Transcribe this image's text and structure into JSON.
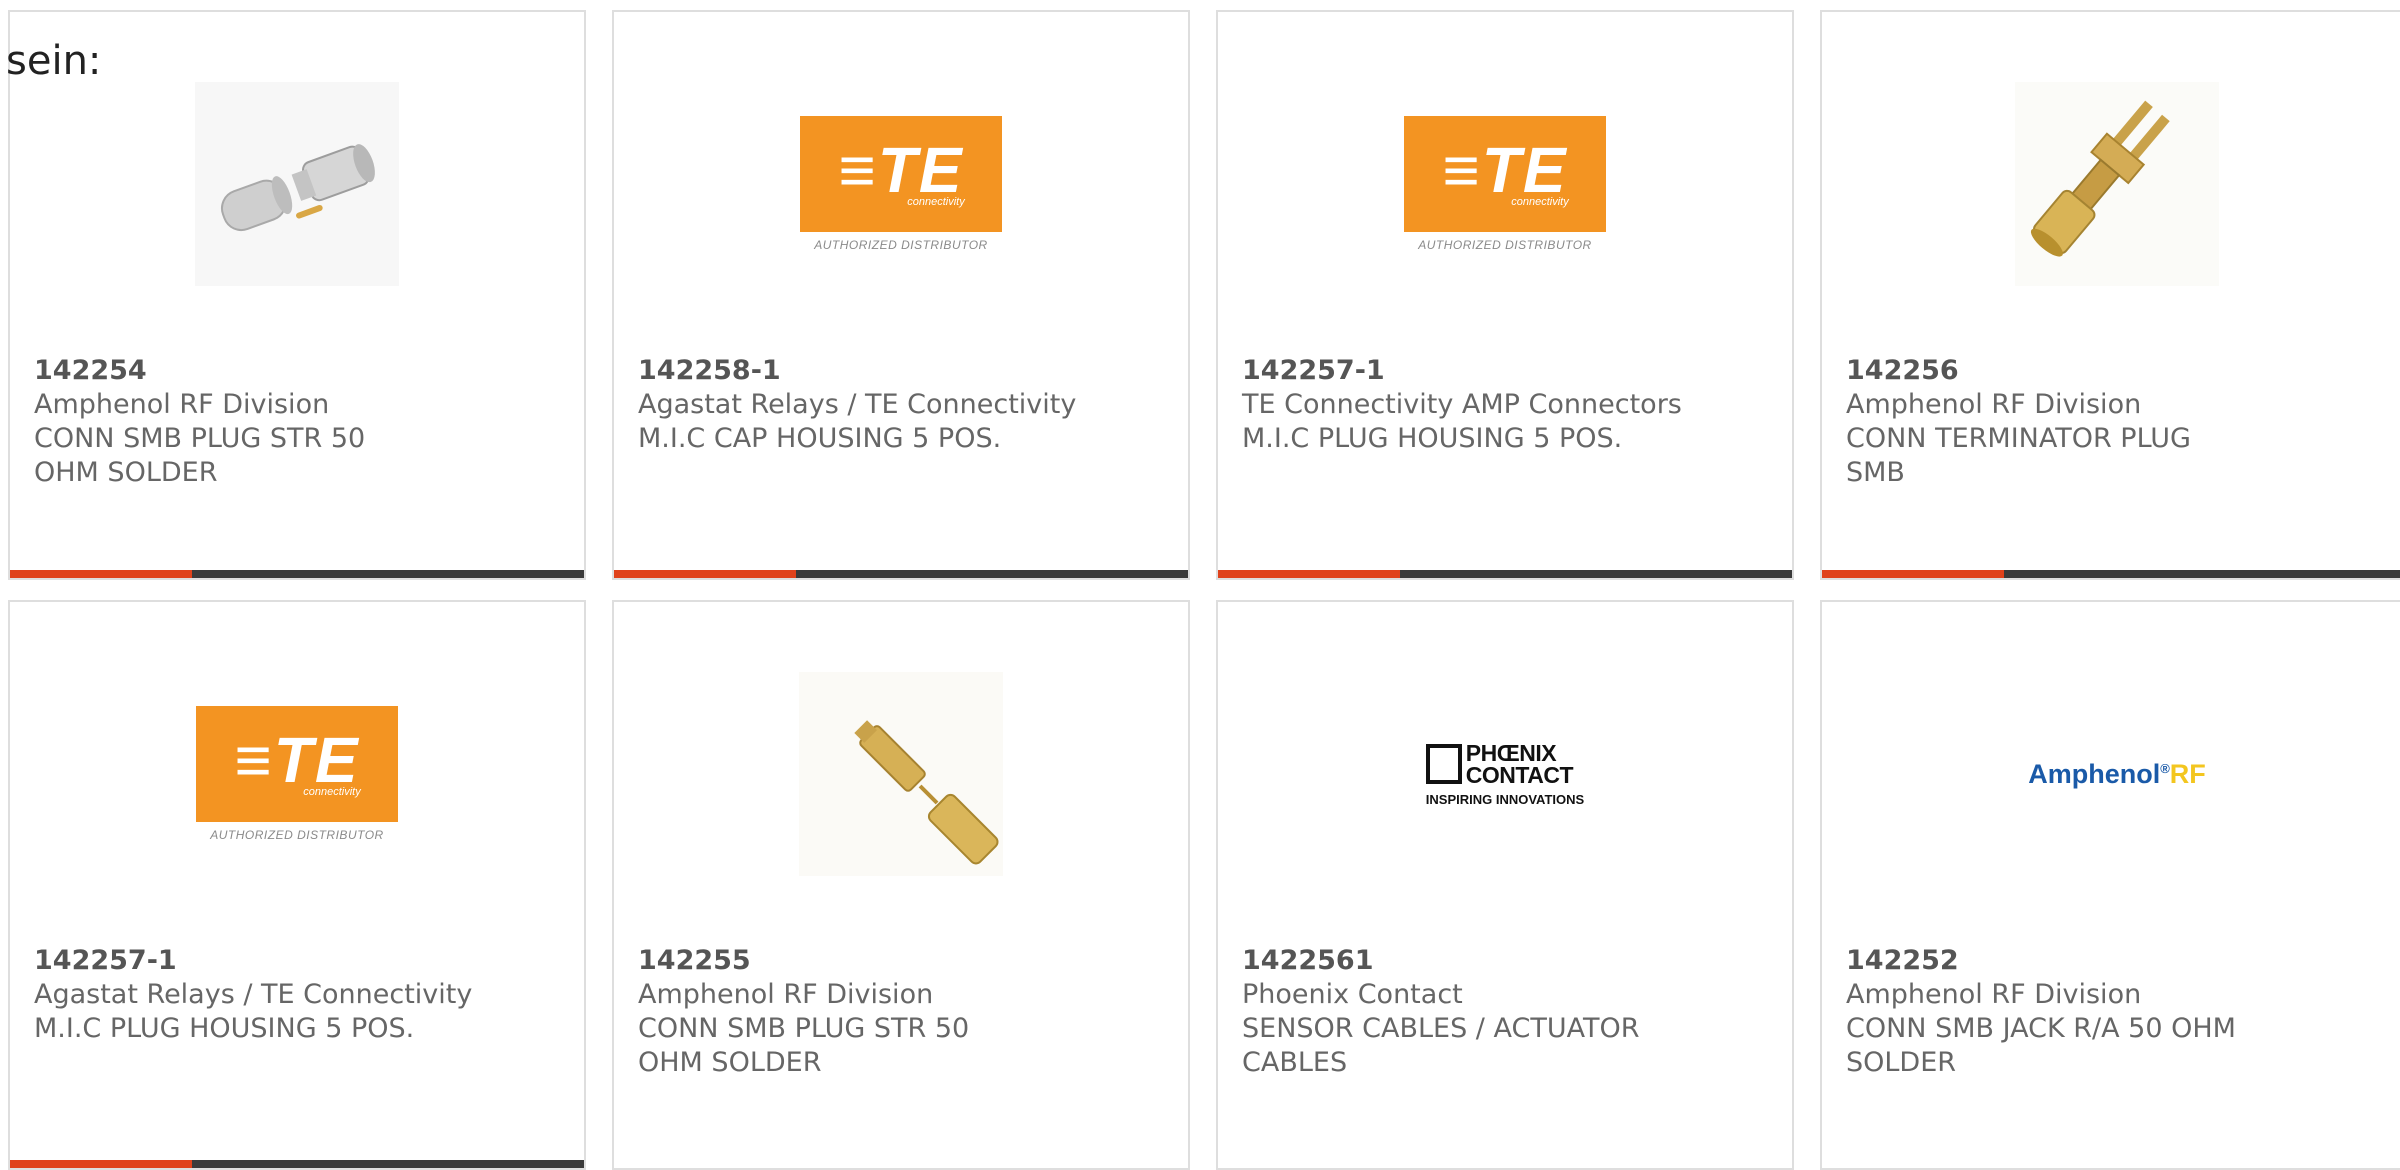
{
  "intro_text": "sein:",
  "colors": {
    "accent": "#e0421b",
    "bar": "#3a3a3a",
    "te_orange": "#f39422",
    "amphenol_blue": "#1a5aa8",
    "amphenol_rf_yellow": "#f3c61f"
  },
  "cards": [
    {
      "part_number": "142254",
      "manufacturer": "Amphenol RF Division",
      "description": "CONN SMB PLUG STR 50 OHM SOLDER",
      "image": "smb-plug-photo"
    },
    {
      "part_number": "142258-1",
      "manufacturer": "Agastat Relays / TE Connectivity",
      "description": "M.I.C CAP HOUSING 5 POS.",
      "image": "te-logo",
      "logo": {
        "mark": "≡TE",
        "sub": "connectivity",
        "caption": "AUTHORIZED DISTRIBUTOR"
      }
    },
    {
      "part_number": "142257-1",
      "manufacturer": "TE Connectivity AMP Connectors",
      "description": "M.I.C PLUG HOUSING 5 POS.",
      "image": "te-logo",
      "logo": {
        "mark": "≡TE",
        "sub": "connectivity",
        "caption": "AUTHORIZED DISTRIBUTOR"
      }
    },
    {
      "part_number": "142256",
      "manufacturer": "Amphenol RF Division",
      "description": "CONN TERMINATOR PLUG SMB",
      "image": "smb-terminator-photo"
    },
    {
      "part_number": "142257-1",
      "manufacturer": "Agastat Relays / TE Connectivity",
      "description": "M.I.C PLUG HOUSING 5 POS.",
      "image": "te-logo",
      "logo": {
        "mark": "≡TE",
        "sub": "connectivity",
        "caption": "AUTHORIZED DISTRIBUTOR"
      }
    },
    {
      "part_number": "142255",
      "manufacturer": "Amphenol RF Division",
      "description": "CONN SMB PLUG STR 50 OHM SOLDER",
      "image": "smb-plug-gold-photo"
    },
    {
      "part_number": "1422561",
      "manufacturer": "Phoenix Contact",
      "description": "SENSOR CABLES / ACTUATOR CABLES",
      "image": "phoenix-contact-logo",
      "logo": {
        "line1": "PHŒNIX",
        "line2": "CONTACT",
        "tagline": "INSPIRING INNOVATIONS"
      }
    },
    {
      "part_number": "142252",
      "manufacturer": "Amphenol RF Division",
      "description": "CONN SMB JACK R/A 50 OHM SOLDER",
      "image": "amphenol-rf-logo",
      "logo": {
        "brand": "Amphenol",
        "reg": "®",
        "suffix": "RF"
      }
    }
  ]
}
